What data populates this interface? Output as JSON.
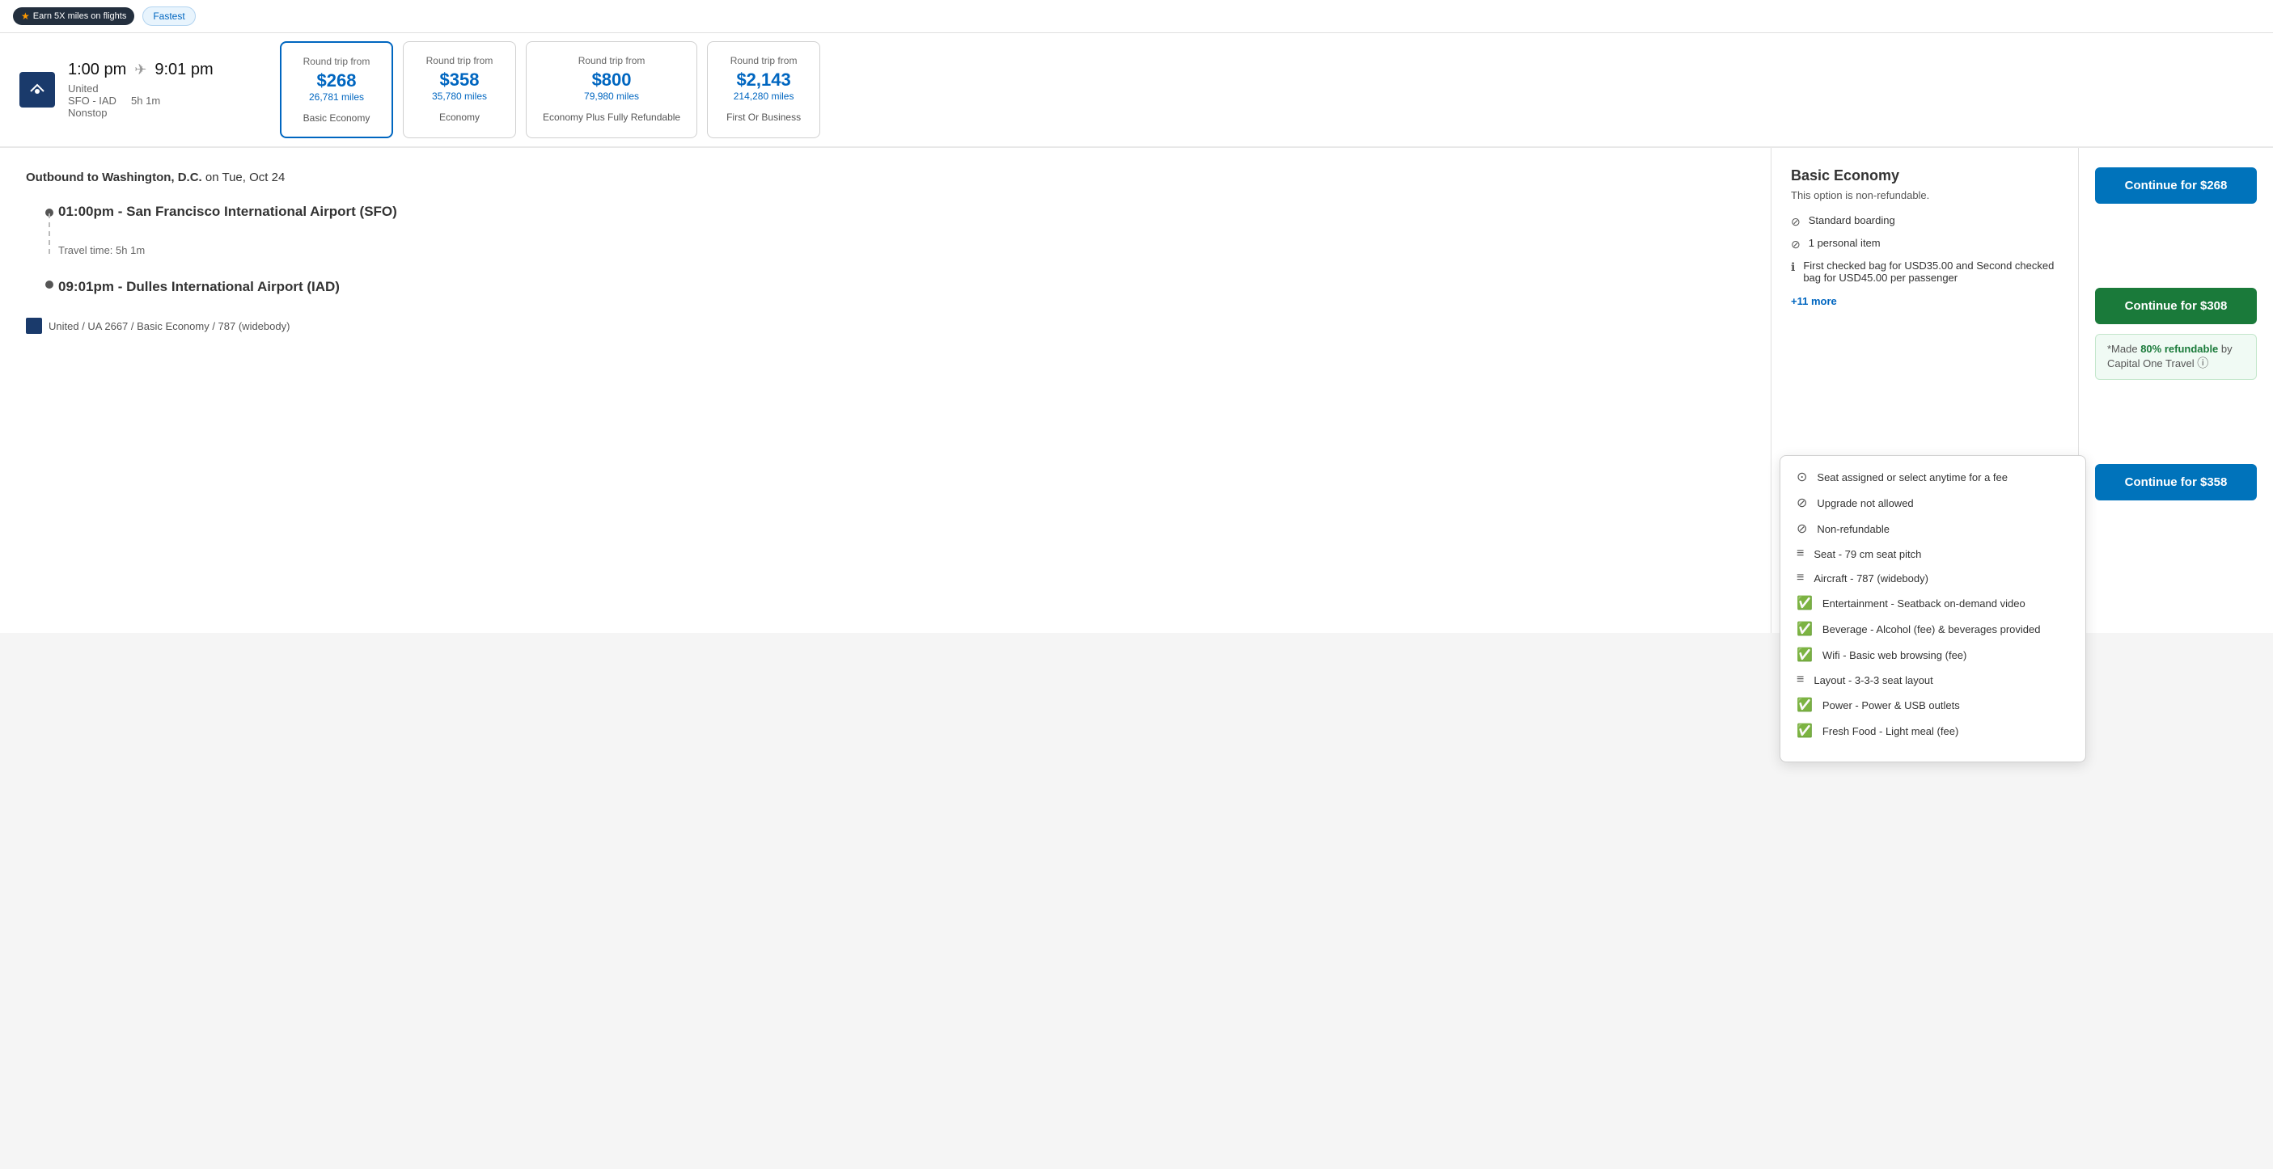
{
  "topbar": {
    "miles_badge": "Earn 5X miles on flights",
    "fastest_badge": "Fastest"
  },
  "flight": {
    "depart_time": "1:00 pm",
    "arrive_time": "9:01 pm",
    "airline": "United",
    "route": "SFO - IAD",
    "duration": "5h 1m",
    "stops": "Nonstop"
  },
  "price_cards": [
    {
      "from_label": "Round trip from",
      "amount": "$268",
      "miles": "26,781 miles",
      "cabin": "Basic Economy",
      "selected": true
    },
    {
      "from_label": "Round trip from",
      "amount": "$358",
      "miles": "35,780 miles",
      "cabin": "Economy",
      "selected": false
    },
    {
      "from_label": "Round trip from",
      "amount": "$800",
      "miles": "79,980 miles",
      "cabin": "Economy Plus Fully Refundable",
      "selected": false
    },
    {
      "from_label": "Round trip from",
      "amount": "$2,143",
      "miles": "214,280 miles",
      "cabin": "First Or Business",
      "selected": false
    }
  ],
  "outbound": {
    "title": "Outbound to Washington, D.C.",
    "date": "on Tue, Oct 24",
    "depart_time": "01:00pm",
    "depart_airport": "San Francisco International Airport (SFO)",
    "travel_time_label": "Travel time: 5h 1m",
    "arrive_time": "09:01pm",
    "arrive_airport": "Dulles International Airport (IAD)",
    "flight_meta": "United / UA 2667 / Basic Economy / 787 (widebody)"
  },
  "fare_details": {
    "cabin_title": "Basic Economy",
    "non_refundable": "This option is non-refundable.",
    "features": [
      {
        "icon": "no",
        "text": "Standard boarding"
      },
      {
        "icon": "no",
        "text": "1 personal item"
      },
      {
        "icon": "info",
        "text": "First checked bag for USD35.00 and Second checked bag for USD45.00 per passenger"
      }
    ],
    "more_link": "+11 more"
  },
  "dropdown_items": [
    {
      "icon": "info",
      "text": "Seat assigned or select anytime for a fee"
    },
    {
      "icon": "no",
      "text": "Upgrade not allowed"
    },
    {
      "icon": "no",
      "text": "Non-refundable"
    },
    {
      "icon": "neutral",
      "text": "Seat - 79 cm seat pitch"
    },
    {
      "icon": "neutral",
      "text": "Aircraft - 787 (widebody)"
    },
    {
      "icon": "check",
      "text": "Entertainment - Seatback on-demand video"
    },
    {
      "icon": "check",
      "text": "Beverage - Alcohol (fee) & beverages provided"
    },
    {
      "icon": "check",
      "text": "Wifi - Basic web browsing (fee)"
    },
    {
      "icon": "neutral",
      "text": "Layout - 3-3-3 seat layout"
    },
    {
      "icon": "check",
      "text": "Power - Power & USB outlets"
    },
    {
      "icon": "check",
      "text": "Fresh Food - Light meal (fee)"
    }
  ],
  "cta": {
    "btn1_label": "Continue for $268",
    "btn2_label": "Continue for $308",
    "refundable_text_1": "*Made ",
    "refundable_bold": "80% refundable",
    "refundable_text_2": " by Capital One Travel",
    "btn3_label": "Continue for $358"
  }
}
